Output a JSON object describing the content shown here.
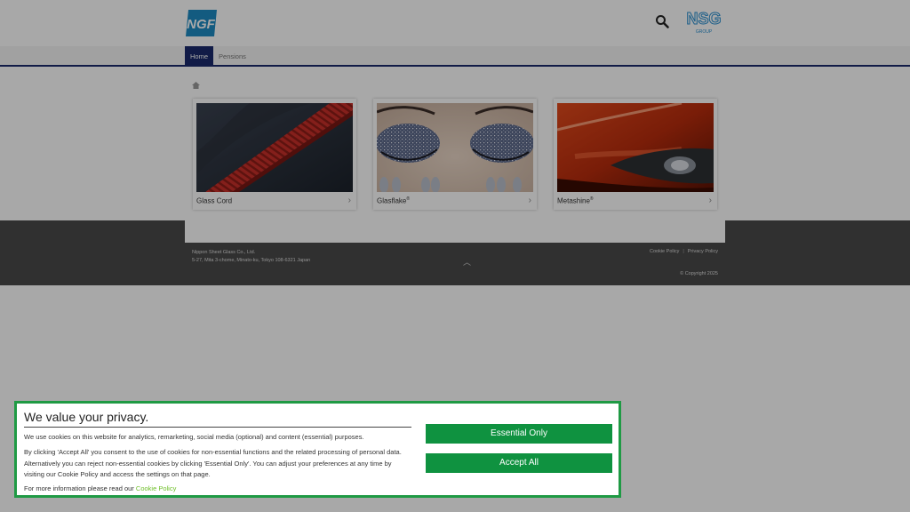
{
  "header": {
    "logo_text": "NGF",
    "group_logo_text": "NSG",
    "group_logo_sub": "GROUP",
    "search_icon": "search-icon"
  },
  "nav": {
    "items": [
      {
        "label": "Home",
        "active": true
      },
      {
        "label": "Pensions",
        "active": false
      }
    ]
  },
  "breadcrumb": {
    "icon": "home-icon"
  },
  "products": [
    {
      "name": "Glass Cord",
      "sup": ""
    },
    {
      "name": "Glasflake",
      "sup": "®"
    },
    {
      "name": "Metashine",
      "sup": "®"
    }
  ],
  "footer": {
    "company_name": "Nippon Sheet Glass Co., Ltd.",
    "address": "5-27, Mita 3-chome, Minato-ku, Tokyo 108-6321 Japan",
    "cookie_policy_link": "Cookie Policy",
    "link_separator": "|",
    "privacy_policy_link": "Privacy Policy",
    "copyright": "© Copyright 2025",
    "back_to_top_icon": "chevron-up-icon"
  },
  "cookie_banner": {
    "title": "We value your privacy.",
    "paragraph1": "We use cookies on this website for analytics, remarketing, social media (optional) and content (essential) purposes.",
    "paragraph2": "By clicking 'Accept All' you consent to the use of cookies for non-essential functions and the related processing of personal data. Alternatively you can reject non-essential cookies by clicking 'Essential Only'. You can adjust your preferences at any time by visiting our Cookie Policy and access the settings on that page.",
    "more_info_prefix": "For more information please read our",
    "more_info_link": "Cookie Policy",
    "essential_button": "Essential Only",
    "accept_button": "Accept All",
    "accent_color": "#0f9240",
    "border_color": "#1f9a44"
  }
}
